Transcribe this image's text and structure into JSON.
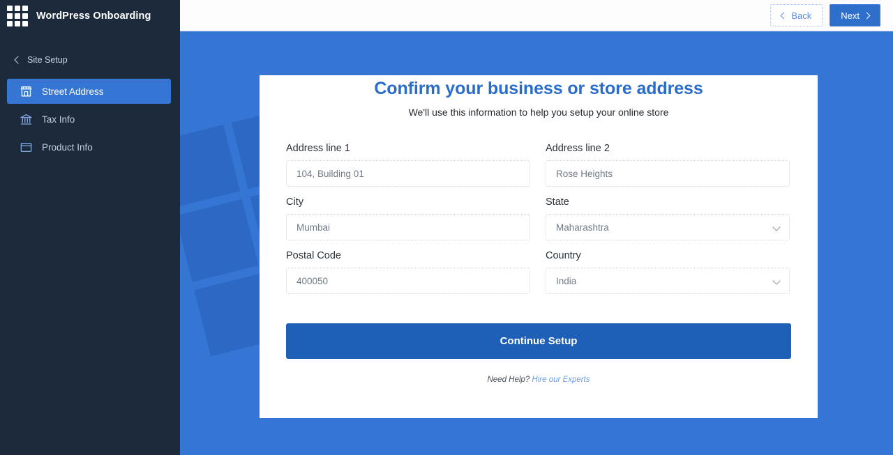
{
  "sidebar": {
    "brand": {
      "title": "WordPress Onboarding",
      "icon": "grid-icon"
    },
    "back": {
      "label": "Site Setup",
      "icon": "chevron-left-icon"
    },
    "items": [
      {
        "label": "Street Address",
        "icon": "storefront-icon",
        "active": true
      },
      {
        "label": "Tax Info",
        "icon": "bank-icon",
        "active": false
      },
      {
        "label": "Product Info",
        "icon": "box-icon",
        "active": false
      }
    ]
  },
  "topbar": {
    "back_label": "Back",
    "next_label": "Next",
    "back_icon": "chevron-left-icon",
    "next_icon": "chevron-right-icon"
  },
  "card": {
    "title": "Confirm your business or store address",
    "subtitle": "We'll use this information to help you setup your online store",
    "fields": [
      {
        "label": "Address line 1",
        "value": "104, Building 01",
        "type": "text"
      },
      {
        "label": "Address line 2",
        "value": "Rose Heights",
        "type": "text"
      },
      {
        "label": "City",
        "value": "Mumbai",
        "type": "text"
      },
      {
        "label": "State",
        "value": "Maharashtra",
        "type": "select"
      },
      {
        "label": "Postal Code",
        "value": "400050",
        "type": "text"
      },
      {
        "label": "Country",
        "value": "India",
        "type": "select"
      }
    ],
    "submit_label": "Continue Setup",
    "help_prefix": "Need Help?",
    "help_link": "Hire our Experts"
  },
  "colors": {
    "accent_blue": "#3575d3",
    "sidebar_navy": "#1d2a3c",
    "title_blue": "#2a6cc9",
    "submit_blue": "#1e5fb8",
    "motif_blue": "#2c68c4",
    "link_blue": "#6f9ee0"
  }
}
